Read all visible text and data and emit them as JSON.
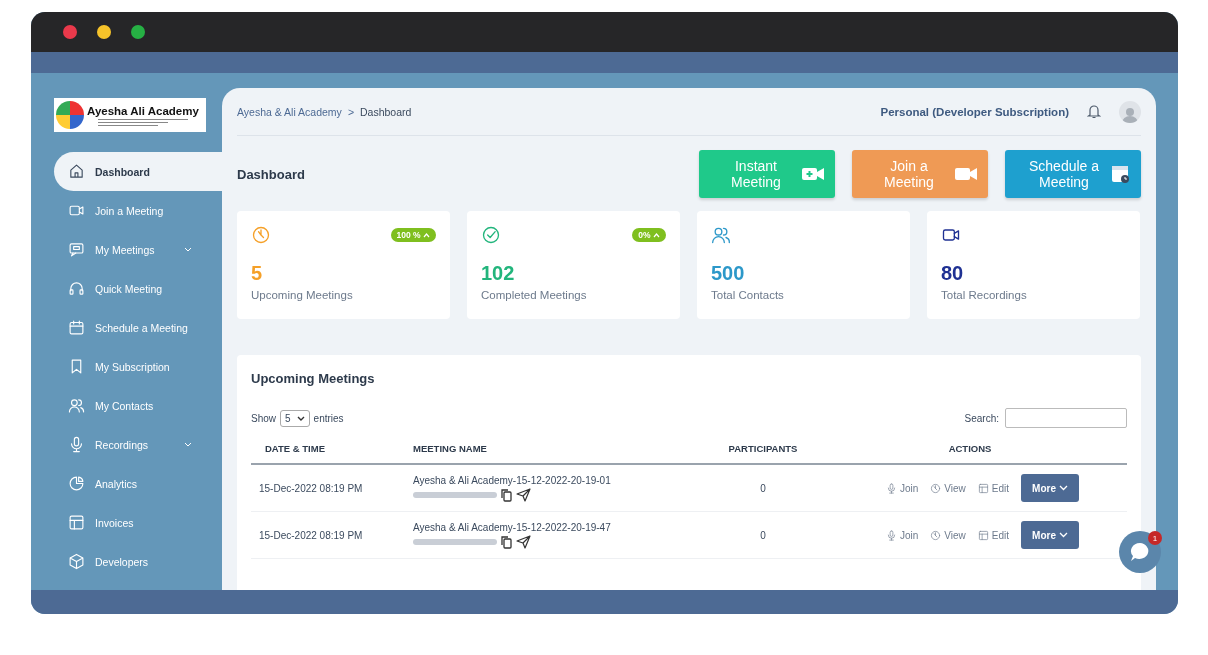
{
  "logo": {
    "title": "Ayesha Ali Academy"
  },
  "sidebar": {
    "items": [
      {
        "label": "Dashboard",
        "selected": true,
        "expandable": false
      },
      {
        "label": "Join a Meeting",
        "selected": false,
        "expandable": false
      },
      {
        "label": "My Meetings",
        "selected": false,
        "expandable": true
      },
      {
        "label": "Quick Meeting",
        "selected": false,
        "expandable": false
      },
      {
        "label": "Schedule a Meeting",
        "selected": false,
        "expandable": false
      },
      {
        "label": "My Subscription",
        "selected": false,
        "expandable": false
      },
      {
        "label": "My Contacts",
        "selected": false,
        "expandable": false
      },
      {
        "label": "Recordings",
        "selected": false,
        "expandable": true
      },
      {
        "label": "Analytics",
        "selected": false,
        "expandable": false
      },
      {
        "label": "Invoices",
        "selected": false,
        "expandable": false
      },
      {
        "label": "Developers",
        "selected": false,
        "expandable": false
      }
    ]
  },
  "breadcrumb": [
    "Ayesha & Ali Academy",
    "Dashboard"
  ],
  "breadcrumb_separator": ">",
  "subscription": "Personal (Developer Subscription)",
  "page_title": "Dashboard",
  "actions": [
    {
      "label": "Instant Meeting",
      "color": "#1fc98a"
    },
    {
      "label": "Join a Meeting",
      "color": "#ef9a55"
    },
    {
      "label": "Schedule a Meeting",
      "color": "#1ea0cf"
    }
  ],
  "stats": [
    {
      "value": "5",
      "label": "Upcoming Meetings",
      "badge": "100 %",
      "color": "#f5a028"
    },
    {
      "value": "102",
      "label": "Completed Meetings",
      "badge": "0%",
      "color": "#22b57c"
    },
    {
      "value": "500",
      "label": "Total Contacts",
      "color": "#2c98c9"
    },
    {
      "value": "80",
      "label": "Total Recordings",
      "color": "#1f3193"
    }
  ],
  "table": {
    "title": "Upcoming Meetings",
    "show_label": "Show",
    "page_size": "5",
    "entries_label": "entries",
    "search_label": "Search:",
    "columns": [
      "DATE & TIME",
      "MEETING NAME",
      "PARTICIPANTS",
      "ACTIONS"
    ],
    "rows": [
      {
        "date": "15-Dec-2022 08:19 PM",
        "name": "Ayesha & Ali Academy-15-12-2022-20-19-01",
        "participants": "0",
        "actions": [
          "Join",
          "View",
          "Edit"
        ],
        "more": "More"
      },
      {
        "date": "15-Dec-2022 08:19 PM",
        "name": "Ayesha & Ali Academy-15-12-2022-20-19-47",
        "participants": "0",
        "actions": [
          "Join",
          "View",
          "Edit"
        ],
        "more": "More"
      }
    ]
  },
  "chat": {
    "badge": "1"
  }
}
